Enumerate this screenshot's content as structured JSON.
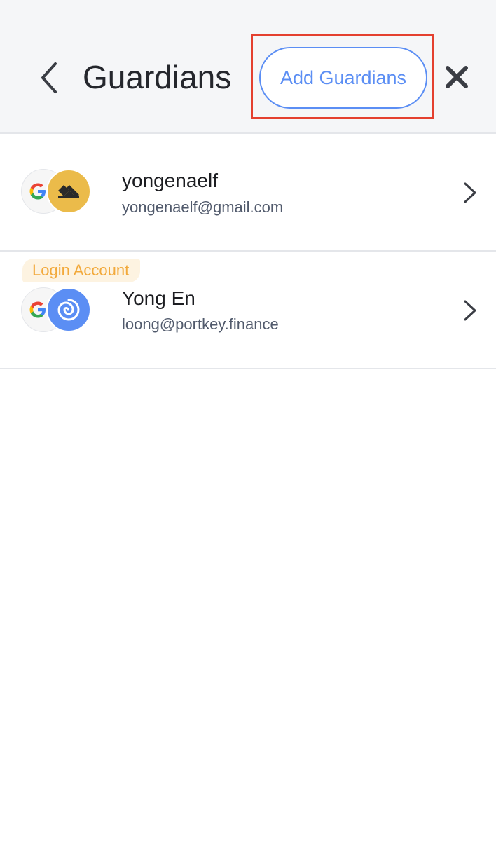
{
  "header": {
    "title": "Guardians",
    "back_icon": "chevron-left-icon",
    "add_button_label": "Add Guardians",
    "close_icon": "close-icon"
  },
  "colors": {
    "accent": "#5b8ef4",
    "highlight": "#e4402f",
    "login_tag_text": "#f2a93b",
    "login_tag_bg": "#fdf3e1",
    "provider_gold": "#ebbb4a"
  },
  "guardians": [
    {
      "name": "yongenaelf",
      "email": "yongenaelf@gmail.com",
      "type_icon": "google-icon",
      "provider_icon": "verifier-gold-icon",
      "tag": ""
    },
    {
      "name": "Yong En",
      "email": "loong@portkey.finance",
      "type_icon": "google-icon",
      "provider_icon": "portkey-swirl-icon",
      "tag": "Login Account"
    }
  ]
}
